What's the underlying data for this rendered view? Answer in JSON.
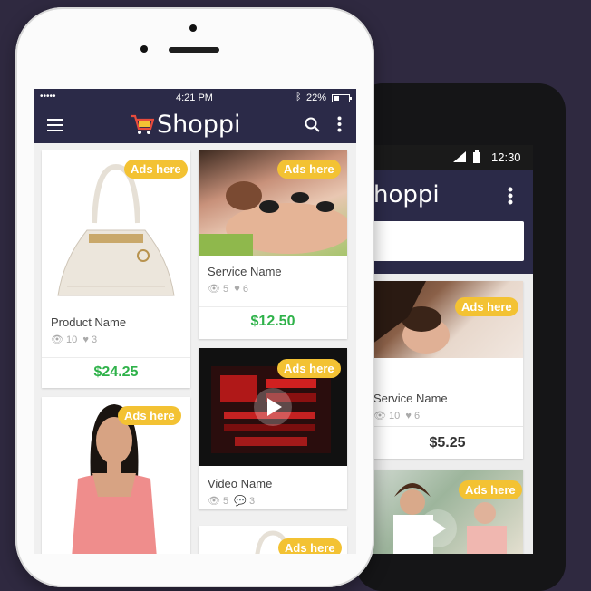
{
  "colors": {
    "background": "#2f2940",
    "header": "#2b2a48",
    "badge": "#f3c233",
    "price": "#2fb24a",
    "price_dark": "#333333"
  },
  "iphone": {
    "status": {
      "carrier": "•••••",
      "time": "4:21 PM",
      "battery": "22%"
    },
    "app_title": "Shoppi",
    "icons": [
      "menu-icon",
      "cart-icon",
      "search-icon",
      "more-icon"
    ],
    "cards": [
      {
        "badge": "Ads here",
        "name": "Product Name",
        "views": "10",
        "likes": "3",
        "price": "$24.25"
      },
      {
        "badge": "Ads here",
        "name": "Service Name",
        "views": "5",
        "likes": "6",
        "price": "$12.50"
      },
      {
        "badge": "Ads here",
        "name": "Video Name",
        "views": "5",
        "comments": "3"
      },
      {
        "badge": "Ads here"
      },
      {
        "badge": "Ads here"
      }
    ]
  },
  "android": {
    "status": {
      "time": "12:30"
    },
    "app_title": "hoppi",
    "cards": [
      {
        "badge": "Ads here",
        "name": "Service Name",
        "views": "10",
        "likes": "6",
        "price": "$5.25"
      },
      {
        "badge": "Ads here"
      }
    ]
  }
}
